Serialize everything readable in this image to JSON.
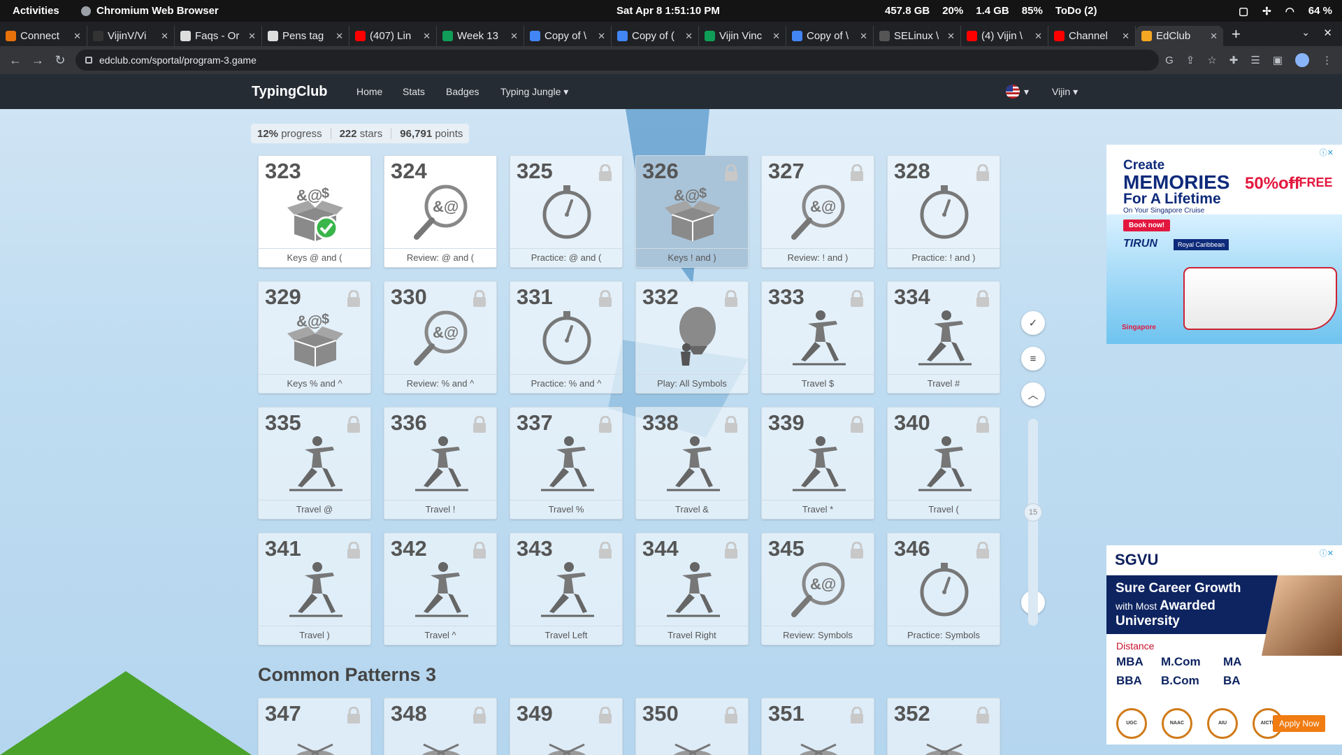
{
  "topbar": {
    "activities": "Activities",
    "app": "Chromium Web Browser",
    "clock": "Sat Apr 8   1:51:10 PM",
    "disk": "457.8 GB",
    "cpu": "20%",
    "mem": "1.4 GB",
    "battery_tray": "85%",
    "todo": "ToDo (2)",
    "battery": "64 %"
  },
  "tabs": [
    {
      "title": "Connect",
      "color": "#e8710a"
    },
    {
      "title": "VijinV/Vi",
      "color": "#333333"
    },
    {
      "title": "Faqs - Or",
      "color": "#dddddd"
    },
    {
      "title": "Pens tag",
      "color": "#dddddd"
    },
    {
      "title": "(407) Lin",
      "color": "#ff0000"
    },
    {
      "title": "Week 13",
      "color": "#0f9d58"
    },
    {
      "title": "Copy of \\",
      "color": "#4285f4"
    },
    {
      "title": "Copy of (",
      "color": "#4285f4"
    },
    {
      "title": "Vijin Vinc",
      "color": "#0f9d58"
    },
    {
      "title": "Copy of \\",
      "color": "#4285f4"
    },
    {
      "title": "SELinux \\",
      "color": "#555555"
    },
    {
      "title": "(4) Vijin \\",
      "color": "#ff0000"
    },
    {
      "title": "Channel",
      "color": "#ff0000"
    },
    {
      "title": "EdClub",
      "color": "#f5a623",
      "active": true
    }
  ],
  "url": "edclub.com/sportal/program-3.game",
  "nav": {
    "brand": "TypingClub",
    "home": "Home",
    "stats": "Stats",
    "badges": "Badges",
    "jungle": "Typing Jungle",
    "user": "Vijin"
  },
  "progress": {
    "percent": "12%",
    "percent_label": "progress",
    "stars": "222",
    "stars_label": "stars",
    "points": "96,791",
    "points_label": "points"
  },
  "lessons": [
    {
      "num": "323",
      "label": "Keys @ and (",
      "icon": "box",
      "status": "done"
    },
    {
      "num": "324",
      "label": "Review: @ and (",
      "icon": "magnifier",
      "status": "open"
    },
    {
      "num": "325",
      "label": "Practice: @ and (",
      "icon": "stopwatch",
      "status": "locked"
    },
    {
      "num": "326",
      "label": "Keys ! and )",
      "icon": "box",
      "status": "current"
    },
    {
      "num": "327",
      "label": "Review: ! and )",
      "icon": "magnifier",
      "status": "locked"
    },
    {
      "num": "328",
      "label": "Practice: ! and )",
      "icon": "stopwatch",
      "status": "locked"
    },
    {
      "num": "329",
      "label": "Keys % and ^",
      "icon": "box",
      "status": "locked"
    },
    {
      "num": "330",
      "label": "Review: % and ^",
      "icon": "magnifier",
      "status": "locked"
    },
    {
      "num": "331",
      "label": "Practice: % and ^",
      "icon": "stopwatch",
      "status": "locked"
    },
    {
      "num": "332",
      "label": "Play: All Symbols",
      "icon": "balloon",
      "status": "locked"
    },
    {
      "num": "333",
      "label": "Travel $",
      "icon": "lunge",
      "status": "locked"
    },
    {
      "num": "334",
      "label": "Travel #",
      "icon": "lunge",
      "status": "locked"
    },
    {
      "num": "335",
      "label": "Travel @",
      "icon": "lunge",
      "status": "locked"
    },
    {
      "num": "336",
      "label": "Travel !",
      "icon": "lunge",
      "status": "locked"
    },
    {
      "num": "337",
      "label": "Travel %",
      "icon": "lunge",
      "status": "locked"
    },
    {
      "num": "338",
      "label": "Travel &",
      "icon": "lunge",
      "status": "locked"
    },
    {
      "num": "339",
      "label": "Travel *",
      "icon": "lunge",
      "status": "locked"
    },
    {
      "num": "340",
      "label": "Travel (",
      "icon": "lunge",
      "status": "locked"
    },
    {
      "num": "341",
      "label": "Travel )",
      "icon": "lunge",
      "status": "locked"
    },
    {
      "num": "342",
      "label": "Travel ^",
      "icon": "lunge",
      "status": "locked"
    },
    {
      "num": "343",
      "label": "Travel Left",
      "icon": "lunge",
      "status": "locked"
    },
    {
      "num": "344",
      "label": "Travel Right",
      "icon": "lunge",
      "status": "locked"
    },
    {
      "num": "345",
      "label": "Review: Symbols",
      "icon": "magnifier",
      "status": "locked"
    },
    {
      "num": "346",
      "label": "Practice: Symbols",
      "icon": "stopwatch",
      "status": "locked"
    }
  ],
  "section2": {
    "title": "Common Patterns 3",
    "lessons": [
      "347",
      "348",
      "349",
      "350",
      "351",
      "352"
    ]
  },
  "sidebar": {
    "page": "15"
  },
  "ad1": {
    "line1": "Create",
    "line2": "MEMORIES",
    "line3": "For A Lifetime",
    "line4": "On Your Singapore Cruise",
    "book": "Book now!",
    "off": "50%off",
    "free": "+ FREE",
    "brand": "TIRUN",
    "brand2": "Royal Caribbean",
    "footer": "Singapore"
  },
  "ad2": {
    "logo": "SGVU",
    "h1": "Sure Career Growth",
    "h2a": "with Most ",
    "h2b": "Awarded",
    "h3": "University",
    "dist": "Distance",
    "deg": [
      "MBA",
      "M.Com",
      "MA",
      "BBA",
      "B.Com",
      "BA"
    ],
    "seals": [
      "UGC",
      "NAAC",
      "AIU",
      "AICTE"
    ],
    "apply": "Apply Now"
  }
}
